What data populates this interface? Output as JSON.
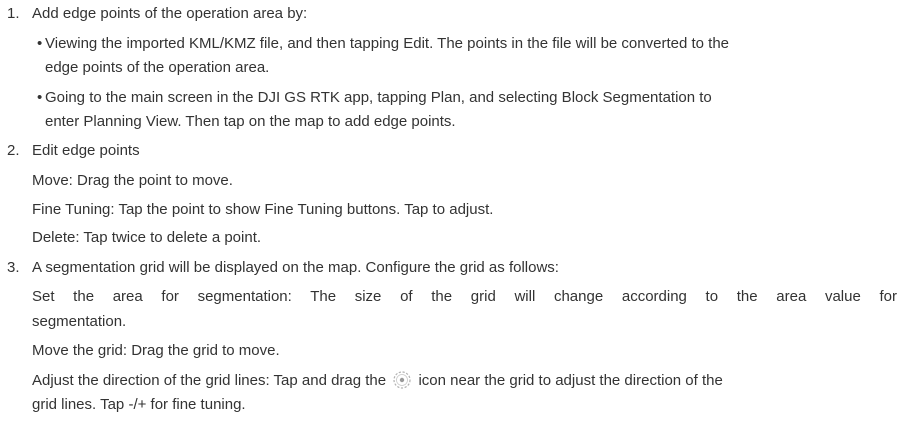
{
  "steps": [
    {
      "number": "1.",
      "title": "Add edge points of the operation area by:",
      "bullets": [
        {
          "symbol": "•",
          "line1": "Viewing the imported KML/KMZ file, and then tapping Edit. The points in the file will be converted to the",
          "line2": "edge points of the operation area."
        },
        {
          "symbol": "•",
          "line1": "Going to the main screen in the DJI GS RTK app, tapping Plan, and selecting Block Segmentation to",
          "line2": "enter Planning View. Then tap on the map to add edge points."
        }
      ]
    },
    {
      "number": "2.",
      "title": "Edit edge points",
      "lines": [
        "Move: Drag the point to move.",
        "Fine Tuning: Tap the point to show Fine Tuning buttons. Tap to adjust.",
        "Delete: Tap twice to delete a point."
      ]
    },
    {
      "number": "3.",
      "title": "A segmentation grid will be displayed on the map. Configure the grid as follows:",
      "area_line1": "Set the area for segmentation: The size of the grid will change according to the area value for",
      "area_line2": "segmentation.",
      "move_grid": "Move the grid: Drag the grid to move.",
      "adjust_before_icon": "Adjust the direction of the grid lines: Tap and drag the",
      "adjust_icon": "rotate-handle-icon",
      "adjust_after_icon": "icon near the grid to adjust the direction of the",
      "adjust_line2": "grid lines. Tap -/+ for fine tuning."
    }
  ]
}
